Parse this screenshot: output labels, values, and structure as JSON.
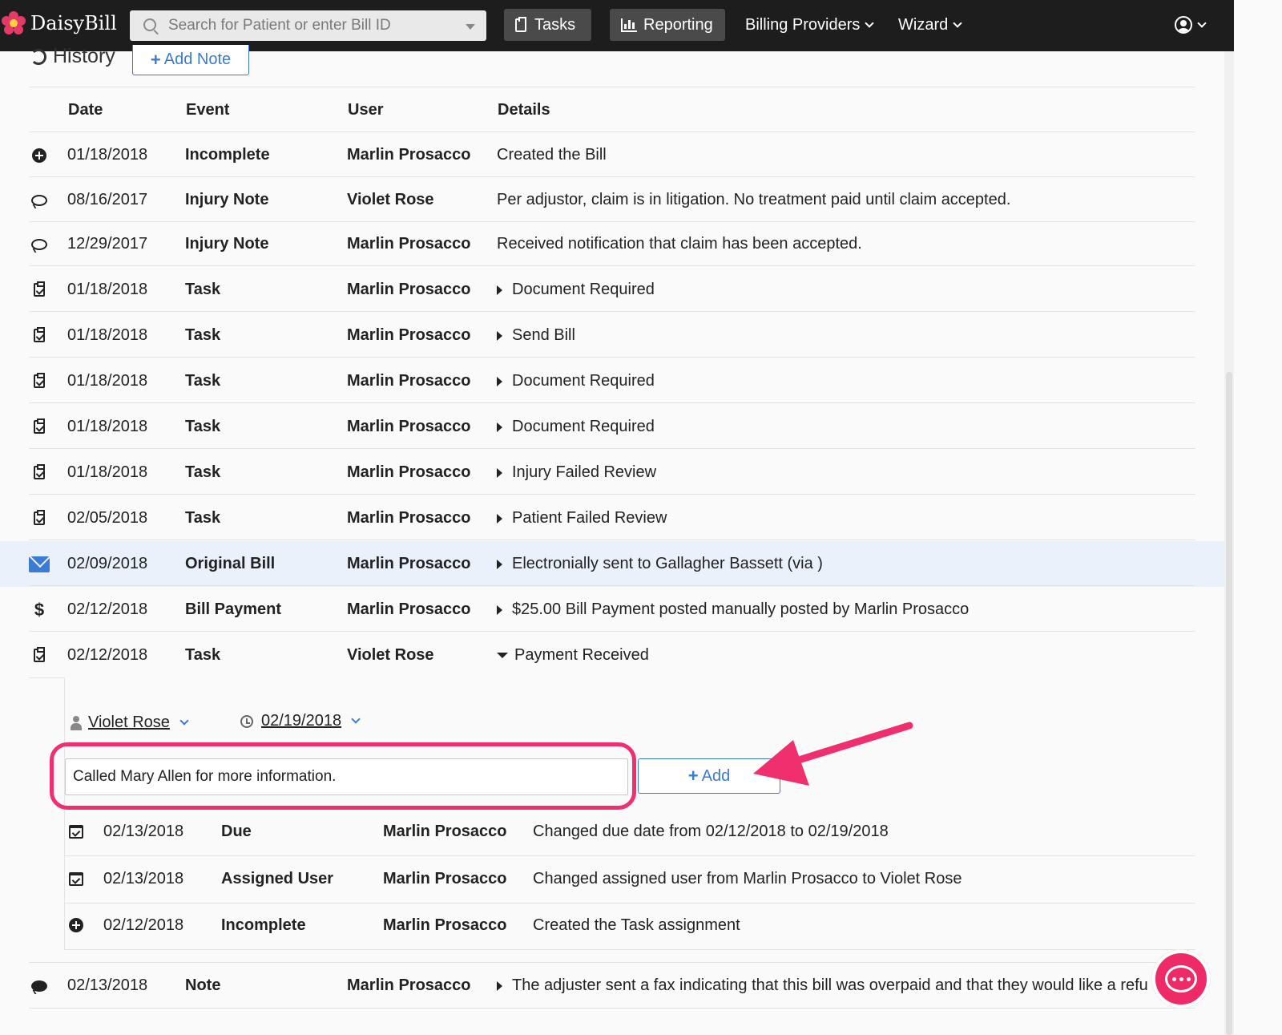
{
  "topbar": {
    "brand": "DaisyBill",
    "search_placeholder": "Search for Patient or enter Bill ID",
    "tasks_label": "Tasks",
    "reporting_label": "Reporting",
    "billing_providers_label": "Billing Providers",
    "wizard_label": "Wizard"
  },
  "history": {
    "title": "History",
    "add_note_label": "Add Note",
    "columns": {
      "date": "Date",
      "event": "Event",
      "user": "User",
      "details": "Details"
    },
    "rows": [
      {
        "icon": "plus-circle-icon",
        "date": "01/18/2018",
        "event": "Incomplete",
        "user": "Marlin Prosacco",
        "details": "Created the Bill",
        "expander": "none"
      },
      {
        "icon": "comment-icon",
        "date": "08/16/2017",
        "event": "Injury Note",
        "user": "Violet Rose",
        "details": "Per adjustor, claim is in litigation. No treatment paid until claim accepted.",
        "expander": "none"
      },
      {
        "icon": "comment-icon",
        "date": "12/29/2017",
        "event": "Injury Note",
        "user": "Marlin Prosacco",
        "details": "Received notification that claim has been accepted.",
        "expander": "none"
      },
      {
        "icon": "clipboard-check-icon",
        "date": "01/18/2018",
        "event": "Task",
        "user": "Marlin Prosacco",
        "details": "Document Required",
        "expander": "collapsed"
      },
      {
        "icon": "clipboard-check-icon",
        "date": "01/18/2018",
        "event": "Task",
        "user": "Marlin Prosacco",
        "details": "Send Bill",
        "expander": "collapsed"
      },
      {
        "icon": "clipboard-check-icon",
        "date": "01/18/2018",
        "event": "Task",
        "user": "Marlin Prosacco",
        "details": "Document Required",
        "expander": "collapsed"
      },
      {
        "icon": "clipboard-check-icon",
        "date": "01/18/2018",
        "event": "Task",
        "user": "Marlin Prosacco",
        "details": "Document Required",
        "expander": "collapsed"
      },
      {
        "icon": "clipboard-check-icon",
        "date": "01/18/2018",
        "event": "Task",
        "user": "Marlin Prosacco",
        "details": "Injury Failed Review",
        "expander": "collapsed"
      },
      {
        "icon": "clipboard-check-icon",
        "date": "02/05/2018",
        "event": "Task",
        "user": "Marlin Prosacco",
        "details": "Patient Failed Review",
        "expander": "collapsed"
      },
      {
        "icon": "envelope-icon",
        "date": "02/09/2018",
        "event": "Original Bill",
        "user": "Marlin Prosacco",
        "details": "Electronially sent to Gallagher Bassett (via )",
        "expander": "collapsed",
        "highlighted": true
      },
      {
        "icon": "dollar-icon",
        "date": "02/12/2018",
        "event": "Bill Payment",
        "user": "Marlin Prosacco",
        "details": "$25.00 Bill Payment posted manually posted by Marlin Prosacco",
        "expander": "collapsed"
      },
      {
        "icon": "clipboard-check-icon",
        "date": "02/12/2018",
        "event": "Task",
        "user": "Violet Rose",
        "details": "Payment Received",
        "expander": "expanded"
      }
    ],
    "task_panel": {
      "assignee": "Violet Rose",
      "due_date": "02/19/2018",
      "note_value": "Called Mary Allen for more information.",
      "add_label": "Add",
      "subrows": [
        {
          "icon": "calendar-check-icon",
          "date": "02/13/2018",
          "event": "Due",
          "user": "Marlin Prosacco",
          "details": "Changed due date from 02/12/2018 to 02/19/2018"
        },
        {
          "icon": "calendar-check-icon",
          "date": "02/13/2018",
          "event": "Assigned User",
          "user": "Marlin Prosacco",
          "details": "Changed assigned user from Marlin Prosacco to Violet Rose"
        },
        {
          "icon": "plus-circle-icon",
          "date": "02/12/2018",
          "event": "Incomplete",
          "user": "Marlin Prosacco",
          "details": "Created the Task assignment"
        }
      ]
    },
    "last_row": {
      "icon": "comment-filled-icon",
      "date": "02/13/2018",
      "event": "Note",
      "user": "Marlin Prosacco",
      "details": "The adjuster sent a fax indicating that this bill was overpaid and that they would like a refu"
    }
  },
  "colors": {
    "accent": "#3a7bd5",
    "highlight": "#f0306e",
    "nav": "#1d1d1d"
  }
}
